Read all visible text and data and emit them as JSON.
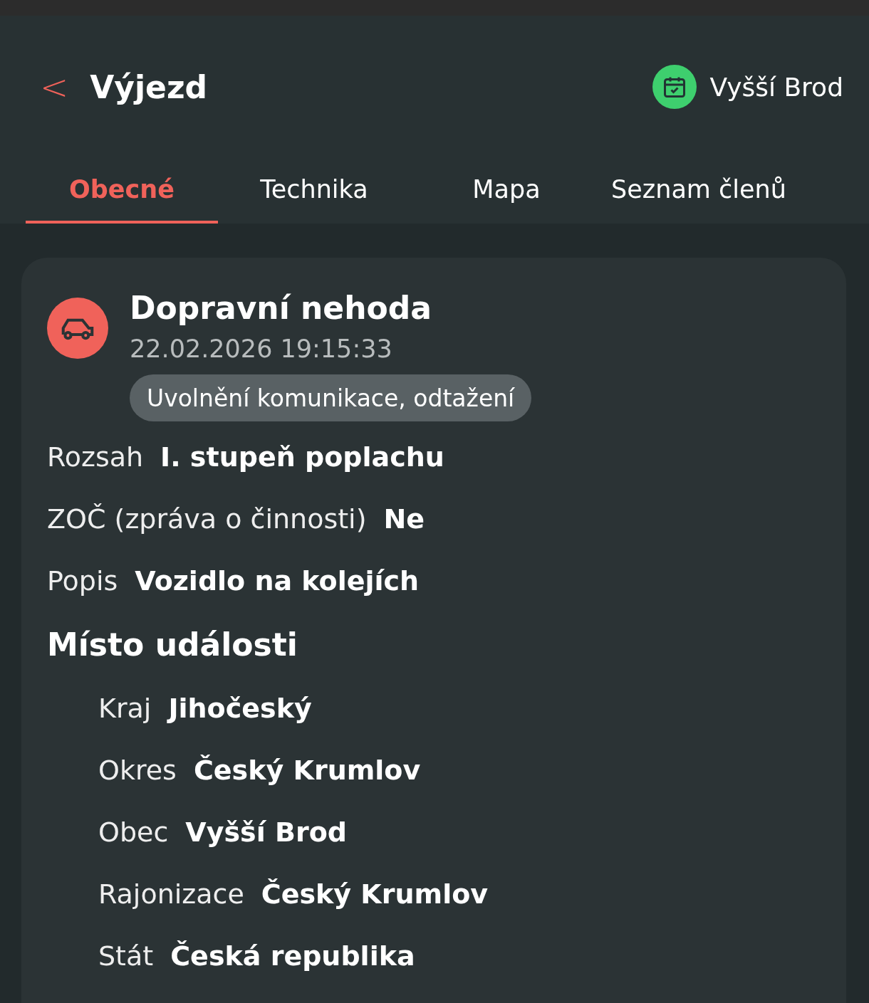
{
  "header": {
    "back": "<",
    "title": "Výjezd",
    "location": "Vyšší Brod"
  },
  "tabs": [
    {
      "label": "Obecné",
      "selected": true
    },
    {
      "label": "Technika",
      "selected": false
    },
    {
      "label": "Mapa",
      "selected": false
    },
    {
      "label": "Seznam členů",
      "selected": false
    }
  ],
  "card": {
    "title": "Dopravní nehoda",
    "datetime": "22.02.2026 19:15:33",
    "tag": "Uvolnění komunikace, odtažení",
    "fields": [
      {
        "label": "Rozsah",
        "value": "I. stupeň poplachu"
      },
      {
        "label": "ZOČ (zpráva o činnosti)",
        "value": "Ne"
      },
      {
        "label": "Popis",
        "value": "Vozidlo na kolejích"
      }
    ],
    "section": {
      "title": "Místo události",
      "fields": [
        {
          "label": "Kraj",
          "value": "Jihočeský"
        },
        {
          "label": "Okres",
          "value": "Český Krumlov"
        },
        {
          "label": "Obec",
          "value": "Vyšší Brod"
        },
        {
          "label": "Rajonizace",
          "value": "Český Krumlov"
        },
        {
          "label": "Stát",
          "value": "Česká republika"
        }
      ]
    }
  }
}
